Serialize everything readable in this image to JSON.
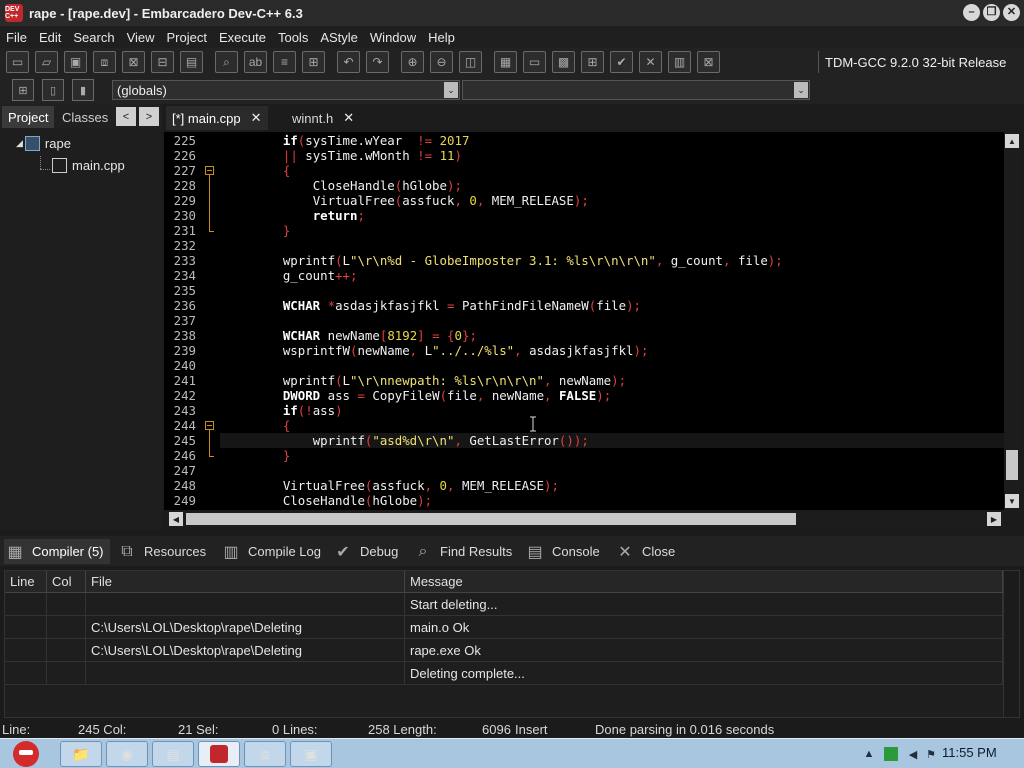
{
  "window": {
    "title": "rape - [rape.dev] - Embarcadero Dev-C++ 6.3",
    "app_icon_text": "DEV C++",
    "controls": [
      "minimize",
      "restore",
      "close"
    ]
  },
  "menu": [
    "File",
    "Edit",
    "Search",
    "View",
    "Project",
    "Execute",
    "Tools",
    "AStyle",
    "Window",
    "Help"
  ],
  "toolbar": {
    "compiler": "TDM-GCC 9.2.0 32-bit Release",
    "scope_combo": "(globals)",
    "function_combo": ""
  },
  "left_panel": {
    "tabs": [
      "Project",
      "Classes"
    ],
    "active_tab": "Project",
    "nav_prev": "<",
    "nav_next": ">",
    "tree": {
      "project": "rape",
      "files": [
        "main.cpp"
      ]
    }
  },
  "editor": {
    "tabs": [
      {
        "label": "[*] main.cpp",
        "active": true
      },
      {
        "label": "winnt.h",
        "active": false
      }
    ],
    "close_glyph": "✕",
    "current_line": "245",
    "lines": [
      {
        "n": "225",
        "code": "    if(sysTime.wYear  != 2017"
      },
      {
        "n": "226",
        "code": "    || sysTime.wMonth != 11)"
      },
      {
        "n": "227",
        "code": "    {"
      },
      {
        "n": "228",
        "code": "        CloseHandle(hGlobe);"
      },
      {
        "n": "229",
        "code": "        VirtualFree(assfuck, 0, MEM_RELEASE);"
      },
      {
        "n": "230",
        "code": "        return;"
      },
      {
        "n": "231",
        "code": "    }"
      },
      {
        "n": "232",
        "code": ""
      },
      {
        "n": "233",
        "code": "    wprintf(L\"\\r\\n%d - GlobeImposter 3.1: %ls\\r\\n\\r\\n\", g_count, file);"
      },
      {
        "n": "234",
        "code": "    g_count++;"
      },
      {
        "n": "235",
        "code": ""
      },
      {
        "n": "236",
        "code": "    WCHAR *asdasjkfasjfkl = PathFindFileNameW(file);"
      },
      {
        "n": "237",
        "code": ""
      },
      {
        "n": "238",
        "code": "    WCHAR newName[8192] = {0};"
      },
      {
        "n": "239",
        "code": "    wsprintfW(newName, L\"../../%ls\", asdasjkfasjfkl);"
      },
      {
        "n": "240",
        "code": ""
      },
      {
        "n": "241",
        "code": "    wprintf(L\"\\r\\nnewpath: %ls\\r\\n\\r\\n\", newName);"
      },
      {
        "n": "242",
        "code": "    DWORD ass = CopyFileW(file, newName, FALSE);"
      },
      {
        "n": "243",
        "code": "    if(!ass)"
      },
      {
        "n": "244",
        "code": "    {"
      },
      {
        "n": "245",
        "code": "        wprintf(\"asd%d\\r\\n\", GetLastError());"
      },
      {
        "n": "246",
        "code": "    }"
      },
      {
        "n": "247",
        "code": ""
      },
      {
        "n": "248",
        "code": "    VirtualFree(assfuck, 0, MEM_RELEASE);"
      },
      {
        "n": "249",
        "code": "    CloseHandle(hGlobe);"
      }
    ]
  },
  "bottom_tabs": [
    {
      "label": "Compiler (5)",
      "icon": "grid-icon",
      "glyph": "▦",
      "active": true
    },
    {
      "label": "Resources",
      "icon": "resources-icon",
      "glyph": "⧉",
      "active": false
    },
    {
      "label": "Compile Log",
      "icon": "bar-chart-icon",
      "glyph": "▥",
      "active": false
    },
    {
      "label": "Debug",
      "icon": "checkmark-icon",
      "glyph": "✔",
      "active": false
    },
    {
      "label": "Find Results",
      "icon": "find-results-icon",
      "glyph": "⌕",
      "active": false
    },
    {
      "label": "Console",
      "icon": "console-icon",
      "glyph": "▤",
      "active": false
    },
    {
      "label": "Close",
      "icon": "close-icon",
      "glyph": "✕",
      "active": false
    }
  ],
  "messages": {
    "columns": [
      "Line",
      "Col",
      "File",
      "Message"
    ],
    "rows": [
      {
        "line": "",
        "col": "",
        "file": "",
        "message": "Start deleting..."
      },
      {
        "line": "",
        "col": "",
        "file": "C:\\Users\\LOL\\Desktop\\rape\\Deleting",
        "message": "main.o Ok"
      },
      {
        "line": "",
        "col": "",
        "file": "C:\\Users\\LOL\\Desktop\\rape\\Deleting",
        "message": "rape.exe Ok"
      },
      {
        "line": "",
        "col": "",
        "file": "",
        "message": "Deleting complete..."
      }
    ]
  },
  "status": {
    "line_label": "Line:",
    "line_value": "245 Col:",
    "col_value": "21 Sel:",
    "sel_value": "0 Lines:",
    "lines_value": "258 Length:",
    "length_value": "6096",
    "mode": "Insert",
    "message": "Done parsing in 0.016 seconds"
  },
  "taskbar": {
    "apps": [
      "explorer",
      "chrome",
      "notepad",
      "devcpp",
      "debugger",
      "window"
    ],
    "clock": "11:55 PM"
  },
  "colors": {
    "editor_bg": "#000000",
    "keyword": "#ffffff",
    "identifier": "#f0f0f0",
    "number": "#e8d848",
    "string": "#f0e070",
    "operator": "#e04040",
    "fold_marker": "#c8901a"
  }
}
